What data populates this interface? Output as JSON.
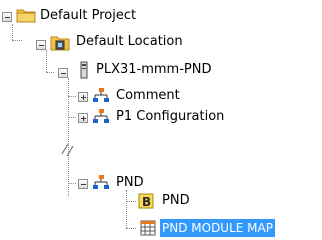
{
  "tree": {
    "root": {
      "label": "Default Project",
      "icon": "folder-icon",
      "expanded": true
    },
    "location": {
      "label": "Default Location",
      "icon": "folder-open-icon",
      "expanded": true
    },
    "device": {
      "label": "PLX31-mmm-PND",
      "icon": "device-icon",
      "expanded": true
    },
    "comment": {
      "label": "Comment",
      "icon": "network-icon",
      "expanded": false
    },
    "p1_config": {
      "label": "P1 Configuration",
      "icon": "network-icon",
      "expanded": false
    },
    "pnd": {
      "label": "PND",
      "icon": "network-icon",
      "expanded": true
    },
    "pnd_child": {
      "label": "PND",
      "icon": "module-b-icon"
    },
    "pnd_module_map": {
      "label": "PND MODULE MAP",
      "icon": "grid-icon",
      "selected": true
    }
  },
  "colors": {
    "selection": "#3399ff",
    "folder": "#f3c24a",
    "network_orange": "#e57a1c",
    "network_blue": "#1f62c8"
  }
}
